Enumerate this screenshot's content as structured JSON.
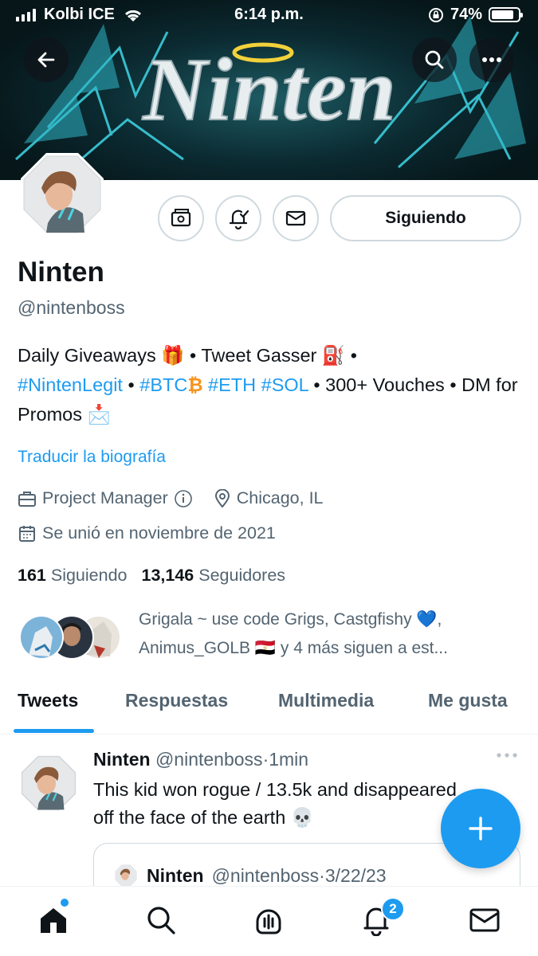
{
  "status_bar": {
    "carrier": "Kolbi ICE",
    "time": "6:14 p.m.",
    "battery": "74%"
  },
  "banner": {
    "logo_text": "Ninten"
  },
  "profile": {
    "name": "Ninten",
    "handle": "@nintenboss",
    "follow_label": "Siguiendo",
    "bio": {
      "part1": "Daily Giveaways",
      "emoji_gift": "🎁",
      "sep1": "•",
      "part2": "Tweet Gasser",
      "emoji_fuel": "⛽",
      "sep2": "•",
      "tag1": "#NintenLegit",
      "sep3": "•",
      "tag2": "#BTC",
      "emoji_btc": "₿",
      "tag3": "#ETH",
      "tag4": "#SOL",
      "sep4": "•",
      "part3": "300+ Vouches",
      "sep5": "•",
      "part4": "DM for Promos",
      "emoji_mail": "📩"
    },
    "translate_label": "Traducir la biografía",
    "category": "Project Manager",
    "location": "Chicago, IL",
    "joined": "Se unió en noviembre de 2021",
    "following_count": "161",
    "following_label": "Siguiendo",
    "followers_count": "13,146",
    "followers_label": "Seguidores",
    "known_followers_line1": "Grigala ~ use code Grigs, Castgfishy 💙,",
    "known_followers_line2": "Animus_GOLB 🇪🇬 y 4 más siguen a est..."
  },
  "tabs": [
    {
      "label": "Tweets",
      "active": true
    },
    {
      "label": "Respuestas",
      "active": false
    },
    {
      "label": "Multimedia",
      "active": false
    },
    {
      "label": "Me gusta",
      "active": false
    }
  ],
  "tweet": {
    "name": "Ninten",
    "handle": "@nintenboss",
    "dot": "·",
    "time": "1min",
    "text_line1": "This kid won rogue / 13.5k and disappeared",
    "text_line2": "off the face of the earth 💀",
    "quote": {
      "name": "Ninten",
      "handle": "@nintenboss",
      "dot": "·",
      "date": "3/22/23"
    }
  },
  "bottom_nav": {
    "items": [
      "home-icon",
      "search-icon",
      "spaces-icon",
      "notifications-icon",
      "messages-icon"
    ],
    "notification_count": "2"
  },
  "colors": {
    "accent": "#1d9bf0",
    "text": "#0f1419",
    "secondary": "#536471",
    "border": "#cfd9de"
  }
}
